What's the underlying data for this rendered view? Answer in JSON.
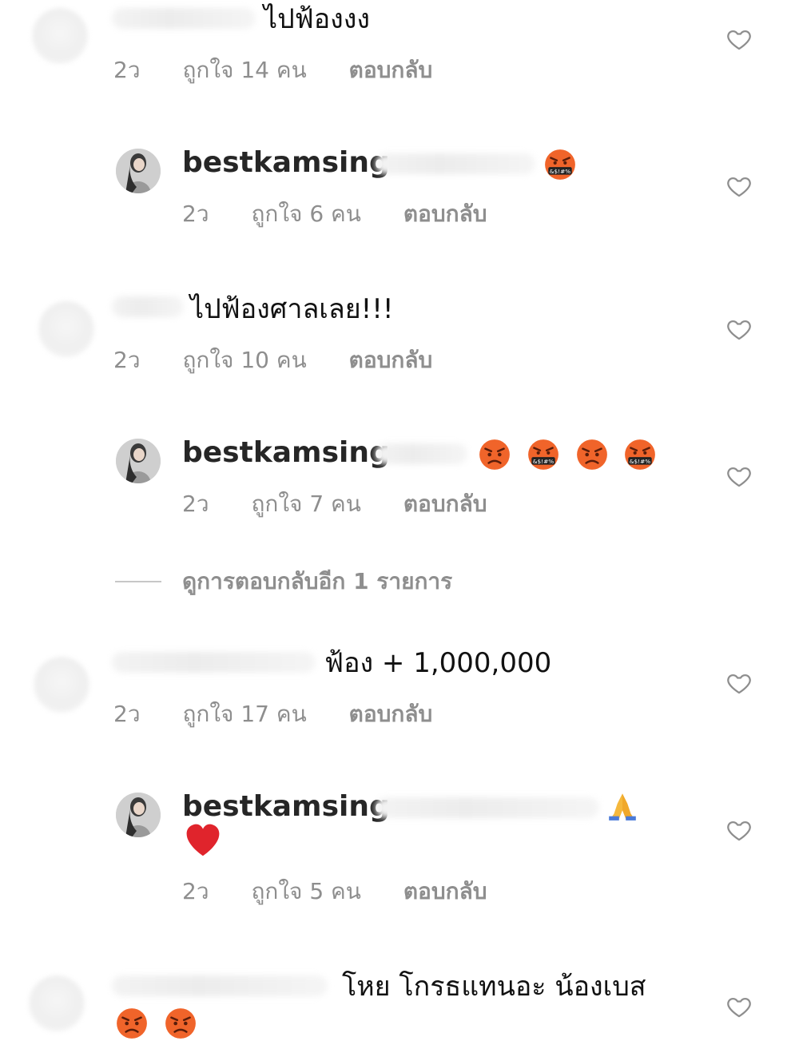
{
  "comments": [
    {
      "username": "",
      "text": "ไปฟ้องงง",
      "time": "2ว",
      "likes": "ถูกใจ 14 คน",
      "reply": "ตอบกลับ"
    },
    {
      "username": "bestkamsing",
      "text": "",
      "emojis": [
        "cursing-face-emoji"
      ],
      "time": "2ว",
      "likes": "ถูกใจ 6 คน",
      "reply": "ตอบกลับ"
    },
    {
      "username": "",
      "text": "ไปฟ้องศาลเลย!!!",
      "time": "2ว",
      "likes": "ถูกใจ 10 คน",
      "reply": "ตอบกลับ"
    },
    {
      "username": "bestkamsing",
      "text": "",
      "emojis": [
        "angry-face-emoji",
        "cursing-face-emoji",
        "angry-face-emoji",
        "cursing-face-emoji"
      ],
      "time": "2ว",
      "likes": "ถูกใจ 7 คน",
      "reply": "ตอบกลับ"
    },
    {
      "username": "",
      "text": "ฟ้อง + 1,000,000",
      "time": "2ว",
      "likes": "ถูกใจ 17 คน",
      "reply": "ตอบกลับ"
    },
    {
      "username": "bestkamsing",
      "text": "",
      "emojis": [
        "folded-hands-emoji",
        "red-heart-emoji"
      ],
      "time": "2ว",
      "likes": "ถูกใจ 5 คน",
      "reply": "ตอบกลับ"
    },
    {
      "username": "",
      "text": "โหย โกรธแทนอะ น้องเบส",
      "emojis": [
        "angry-face-emoji",
        "angry-face-emoji"
      ]
    }
  ],
  "view_more_replies": "ดูการตอบกลับอีก 1 รายการ",
  "icons": {
    "like": "heart-outline-icon"
  },
  "colors": {
    "meta_text": "#8e8e8e",
    "username": "#262626",
    "angry_emoji": "#f0642a",
    "heart_emoji": "#e0242c"
  }
}
